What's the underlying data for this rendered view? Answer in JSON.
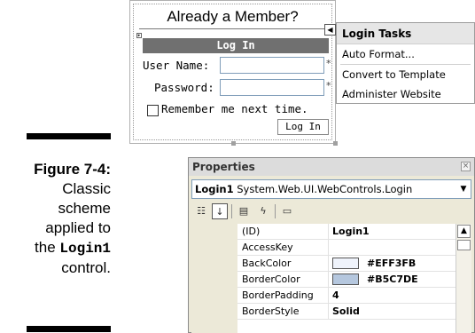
{
  "caption": {
    "figure_label": "Figure 7-4:",
    "lines": [
      "Classic",
      "scheme",
      "applied to"
    ],
    "last_prefix": "the ",
    "control_code": "Login1",
    "last_line": "control."
  },
  "login_control": {
    "member_title": "Already a Member?",
    "header": "Log In",
    "username_label": "User Name:",
    "password_label": "Password:",
    "required_marker": "*",
    "remember_label": "Remember me next time.",
    "login_button": "Log In"
  },
  "tasks_panel": {
    "title": "Login Tasks",
    "items": [
      "Auto Format...",
      "Convert to Template",
      "Administer Website"
    ]
  },
  "properties": {
    "title": "Properties",
    "object_name": "Login1",
    "object_type": "System.Web.UI.WebControls.Login",
    "rows": [
      {
        "name": "(ID)",
        "value": "Login1"
      },
      {
        "name": "AccessKey",
        "value": ""
      },
      {
        "name": "BackColor",
        "value": "#EFF3FB",
        "swatch": "#EFF3FB"
      },
      {
        "name": "BorderColor",
        "value": "#B5C7DE",
        "swatch": "#B5C7DE"
      },
      {
        "name": "BorderPadding",
        "value": "4"
      },
      {
        "name": "BorderStyle",
        "value": "Solid"
      }
    ]
  },
  "icons": {
    "smart_tag": "triangle-left",
    "close": "close-x",
    "categorized": "categorized-icon",
    "alphabetical": "sort-az-icon",
    "properties": "properties-icon",
    "events": "lightning-icon",
    "property_pages": "property-pages-icon"
  },
  "colors": {
    "login_header_bg": "#707070",
    "panel_bg": "#ece9d8",
    "backcolor_swatch": "#EFF3FB",
    "bordercolor_swatch": "#B5C7DE"
  }
}
